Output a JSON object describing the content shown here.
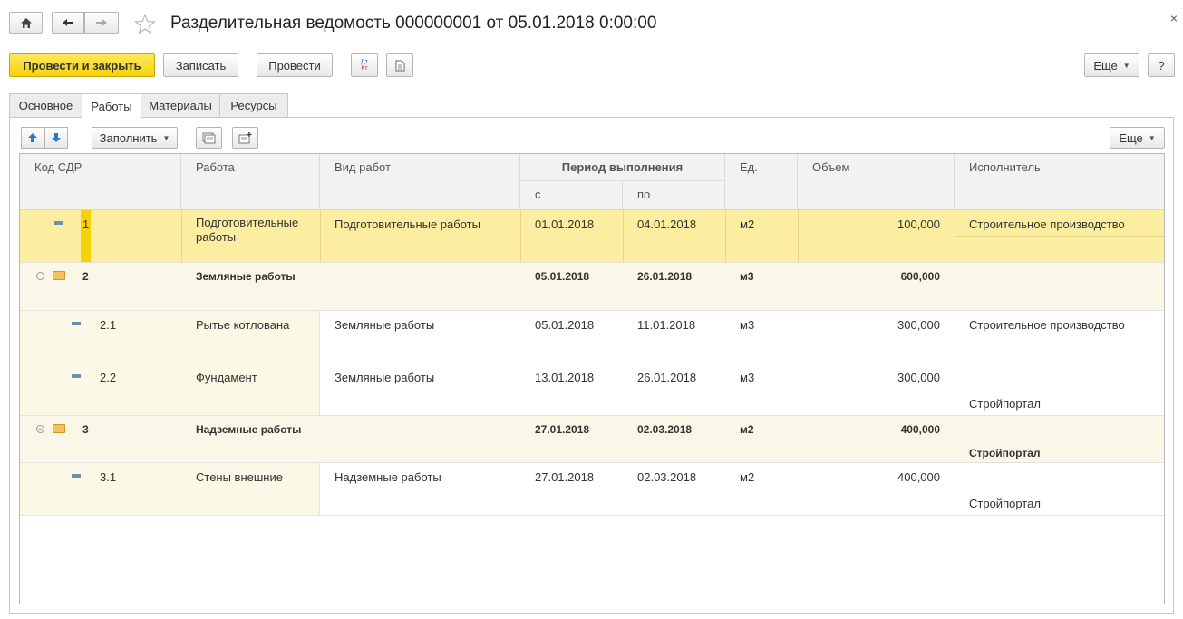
{
  "window": {
    "title": "Разделительная ведомость 000000001 от 05.01.2018 0:00:00",
    "close_glyph": "×"
  },
  "toolbar": {
    "post_close_label": "Провести и закрыть",
    "save_label": "Записать",
    "post_label": "Провести",
    "more_label": "Еще",
    "help_label": "?",
    "dt_kt_label": "Дт Кт"
  },
  "tabs": [
    {
      "label": "Основное",
      "active": false
    },
    {
      "label": "Работы",
      "active": true
    },
    {
      "label": "Материалы",
      "active": false
    },
    {
      "label": "Ресурсы",
      "active": false
    }
  ],
  "table_toolbar": {
    "fill_label": "Заполнить",
    "more_label": "Еще"
  },
  "table": {
    "headers": {
      "code": "Код СДР",
      "work": "Работа",
      "work_type": "Вид работ",
      "period": "Период выполнения",
      "period_from": "с",
      "period_to": "по",
      "unit": "Ед.",
      "volume": "Объем",
      "executor": "Исполнитель"
    },
    "rows": [
      {
        "code": "1",
        "work": "Подготовительные работы",
        "work_l1": "Подготовительные",
        "work_l2": "работы",
        "work_type": "Подготовительные работы",
        "from": "01.01.2018",
        "to": "04.01.2018",
        "unit": "м2",
        "volume": "100,000",
        "executor": "Строительное производство",
        "executor2": "",
        "group": false,
        "selected": true
      },
      {
        "code": "2",
        "work": "Земляные работы",
        "work_type": "",
        "from": "05.01.2018",
        "to": "26.01.2018",
        "unit": "м3",
        "volume": "600,000",
        "executor": "",
        "executor2": "",
        "group": true
      },
      {
        "code": "2.1",
        "work": "Рытье котлована",
        "work_type": "Земляные работы",
        "from": "05.01.2018",
        "to": "11.01.2018",
        "unit": "м3",
        "volume": "300,000",
        "executor": "Строительное производство",
        "executor2": "",
        "group": false
      },
      {
        "code": "2.2",
        "work": "Фундамент",
        "work_type": "Земляные работы",
        "from": "13.01.2018",
        "to": "26.01.2018",
        "unit": "м3",
        "volume": "300,000",
        "executor": "",
        "executor2": "Стройпортал",
        "group": false
      },
      {
        "code": "3",
        "work": "Надземные работы",
        "work_type": "",
        "from": "27.01.2018",
        "to": "02.03.2018",
        "unit": "м2",
        "volume": "400,000",
        "executor": "",
        "executor2": "Стройпортал",
        "group": true
      },
      {
        "code": "3.1",
        "work": "Стены внешние",
        "work_type": "Надземные работы",
        "from": "27.01.2018",
        "to": "02.03.2018",
        "unit": "м2",
        "volume": "400,000",
        "executor": "",
        "executor2": "Стройпортал",
        "group": false
      }
    ]
  },
  "colors": {
    "primary_button": "#f5d20a",
    "selected_row": "#fbeea0",
    "group_row": "#faf7e8",
    "tree_column": "#fbf8e6"
  }
}
